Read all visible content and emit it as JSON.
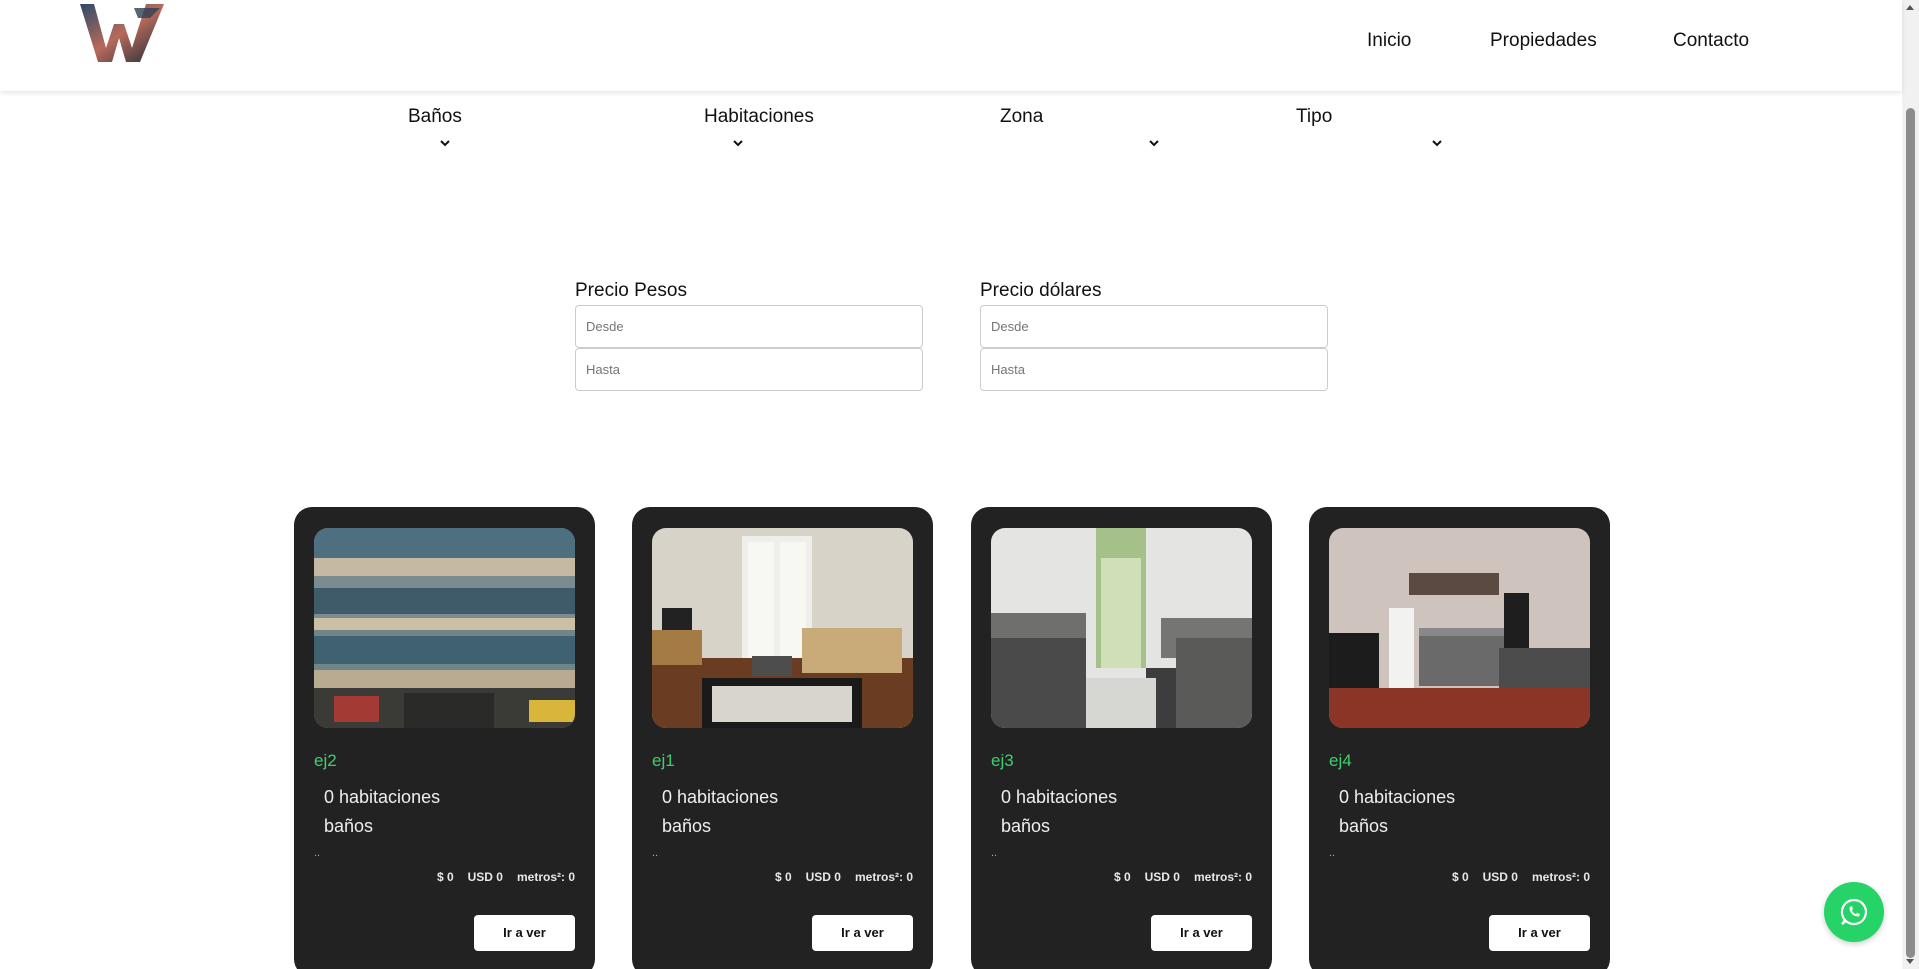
{
  "header": {
    "logo_icon": "stylized-w-logo-icon",
    "nav": [
      {
        "label": "Inicio"
      },
      {
        "label": "Propiedades"
      },
      {
        "label": "Contacto"
      }
    ]
  },
  "filters": [
    {
      "label": "Baños",
      "icon": "chevron-down-icon"
    },
    {
      "label": "Habitaciones",
      "icon": "chevron-down-icon"
    },
    {
      "label": "Zona",
      "icon": "chevron-down-icon"
    },
    {
      "label": "Tipo",
      "icon": "chevron-down-icon"
    }
  ],
  "price": {
    "pesos": {
      "label": "Precio Pesos",
      "from_placeholder": "Desde",
      "to_placeholder": "Hasta"
    },
    "dollars": {
      "label": "Precio dólares",
      "from_placeholder": "Desde",
      "to_placeholder": "Hasta"
    }
  },
  "cards": [
    {
      "title": "ej2",
      "rooms": "0 habitaciones",
      "baths": "baños",
      "dots": "..",
      "pesos": "$ 0",
      "usd": "USD 0",
      "meters": "metros²: 0",
      "button": "Ir a ver",
      "photo": "building-facade-photo"
    },
    {
      "title": "ej1",
      "rooms": "0 habitaciones",
      "baths": "baños",
      "dots": "..",
      "pesos": "$ 0",
      "usd": "USD 0",
      "meters": "metros²: 0",
      "button": "Ir a ver",
      "photo": "living-room-photo"
    },
    {
      "title": "ej3",
      "rooms": "0 habitaciones",
      "baths": "baños",
      "dots": "..",
      "pesos": "$ 0",
      "usd": "USD 0",
      "meters": "metros²: 0",
      "button": "Ir a ver",
      "photo": "kitchen-photo"
    },
    {
      "title": "ej4",
      "rooms": "0 habitaciones",
      "baths": "baños",
      "dots": "..",
      "pesos": "$ 0",
      "usd": "USD 0",
      "meters": "metros²: 0",
      "button": "Ir a ver",
      "photo": "kitchen-photo"
    }
  ],
  "whatsapp_icon": "whatsapp-icon",
  "colors": {
    "accent": "#3ecf6e",
    "card_bg": "#222222",
    "whatsapp": "#25d366"
  }
}
